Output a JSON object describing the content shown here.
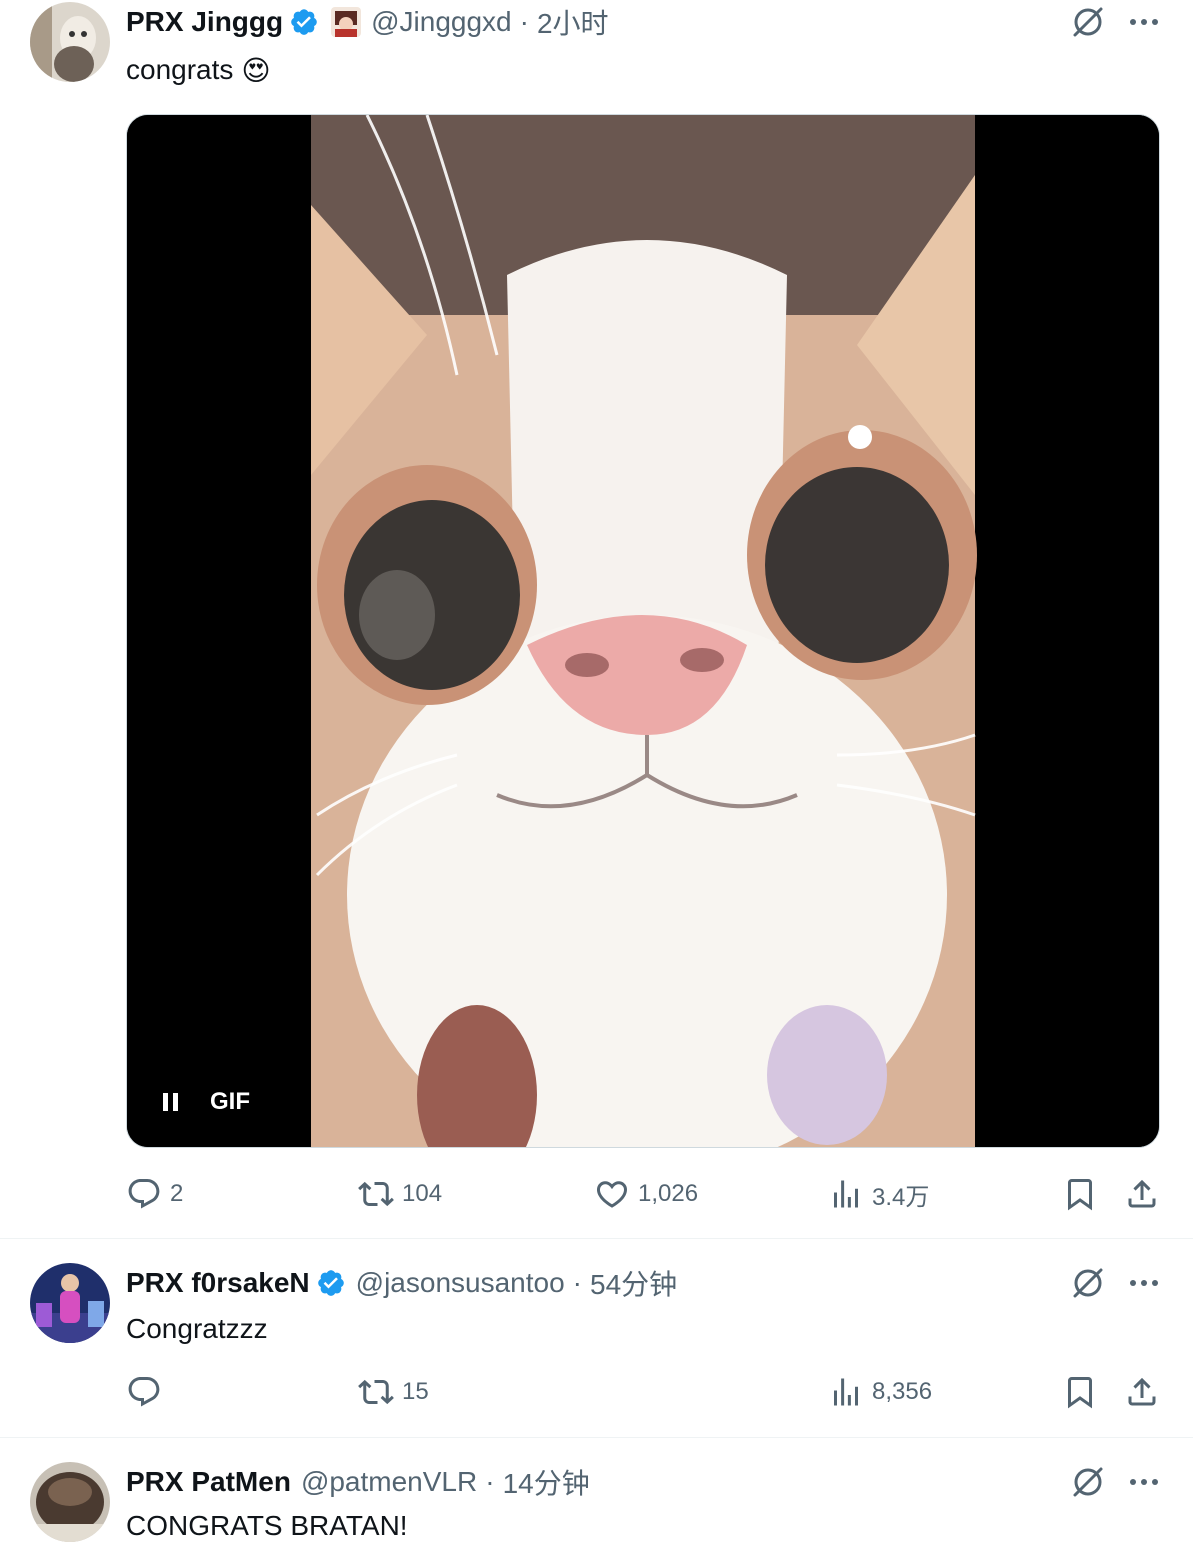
{
  "tweets": [
    {
      "name": "PRX Jinggg",
      "verified": true,
      "handle": "@Jingggxd",
      "sep": "·",
      "time": "2小时",
      "text": "congrats",
      "emoji": "😍",
      "media": {
        "label": "GIF"
      },
      "replies": "2",
      "retweets": "104",
      "likes": "1,026",
      "views": "3.4万"
    },
    {
      "name": "PRX f0rsakeN",
      "verified": true,
      "handle": "@jasonsusantoo",
      "sep": "·",
      "time": "54分钟",
      "text": "Congratzzz",
      "replies": "",
      "retweets": "15",
      "likes": "",
      "views": "8,356"
    },
    {
      "name": "PRX PatMen",
      "verified": false,
      "handle": "@patmenVLR",
      "sep": "·",
      "time": "14分钟",
      "text": "CONGRATS BRATAN!"
    }
  ],
  "icons": {
    "verified": "verified-badge-icon",
    "grok": "grok-icon",
    "more": "more-icon",
    "reply": "reply-icon",
    "retweet": "retweet-icon",
    "like": "like-icon",
    "views": "views-icon",
    "bookmark": "bookmark-icon",
    "share": "share-icon",
    "pause": "pause-icon"
  },
  "colors": {
    "verified": "#1d9bf0",
    "secondary_text": "#536471",
    "primary_text": "#0f1419",
    "divider": "#eff3f4"
  }
}
